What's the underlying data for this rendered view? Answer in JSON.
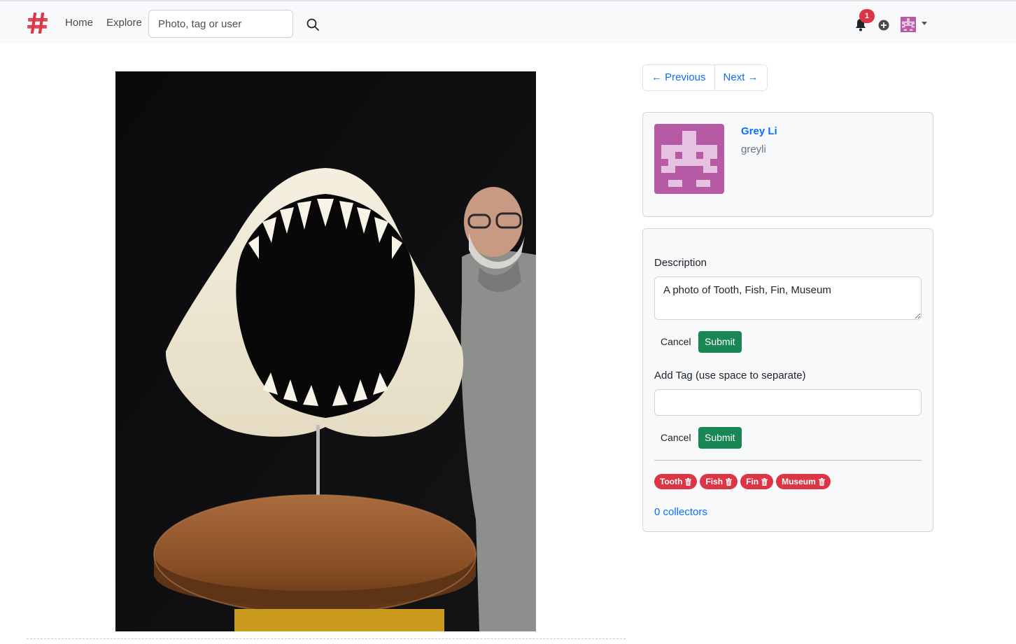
{
  "navbar": {
    "home_label": "Home",
    "explore_label": "Explore",
    "search_placeholder": "Photo, tag or user",
    "notification_count": "1",
    "accent_color": "#dc3545"
  },
  "pager": {
    "previous_label": "← Previous",
    "next_label": "Next →"
  },
  "profile": {
    "name": "Grey Li",
    "username": "greyli",
    "avatar_color": "#b75aa6"
  },
  "edit": {
    "description_label": "Description",
    "description_value": "A photo of Tooth, Fish, Fin, Museum",
    "cancel_label": "Cancel",
    "submit_label": "Submit",
    "add_tag_label": "Add Tag (use space to separate)",
    "add_tag_value": ""
  },
  "tags": [
    {
      "label": "Tooth"
    },
    {
      "label": "Fish"
    },
    {
      "label": "Fin"
    },
    {
      "label": "Museum"
    }
  ],
  "collectors_label": "0 collectors"
}
